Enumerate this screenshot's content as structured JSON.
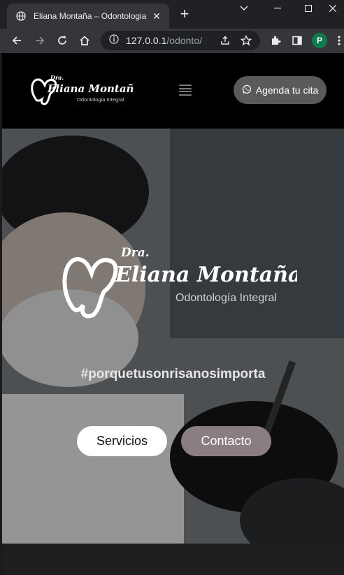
{
  "browser": {
    "tab_title": "Eliana Montaña – Odontologia Inte",
    "url_host": "127.0.0.1",
    "url_path": "/odonto/",
    "profile_initial": "P"
  },
  "header": {
    "logo_small": {
      "prefix": "Dra.",
      "name": "Eliana Montaña",
      "tagline": "Odontologia Integral"
    },
    "cta_label": "Agenda tu cita"
  },
  "hero": {
    "logo": {
      "prefix": "Dra.",
      "name": "Eliana Montaña",
      "tagline": "Odontología Integral"
    },
    "hashtag": "#porquetusonrisanosimporta",
    "buttons": {
      "servicios": "Servicios",
      "contacto": "Contacto"
    }
  },
  "colors": {
    "header_bg": "#000000",
    "cta_bg": "#5a5a5a",
    "contacto_bg": "#8a7e80",
    "servicios_bg": "#ffffff",
    "profile_bg": "#0e7a4d"
  }
}
